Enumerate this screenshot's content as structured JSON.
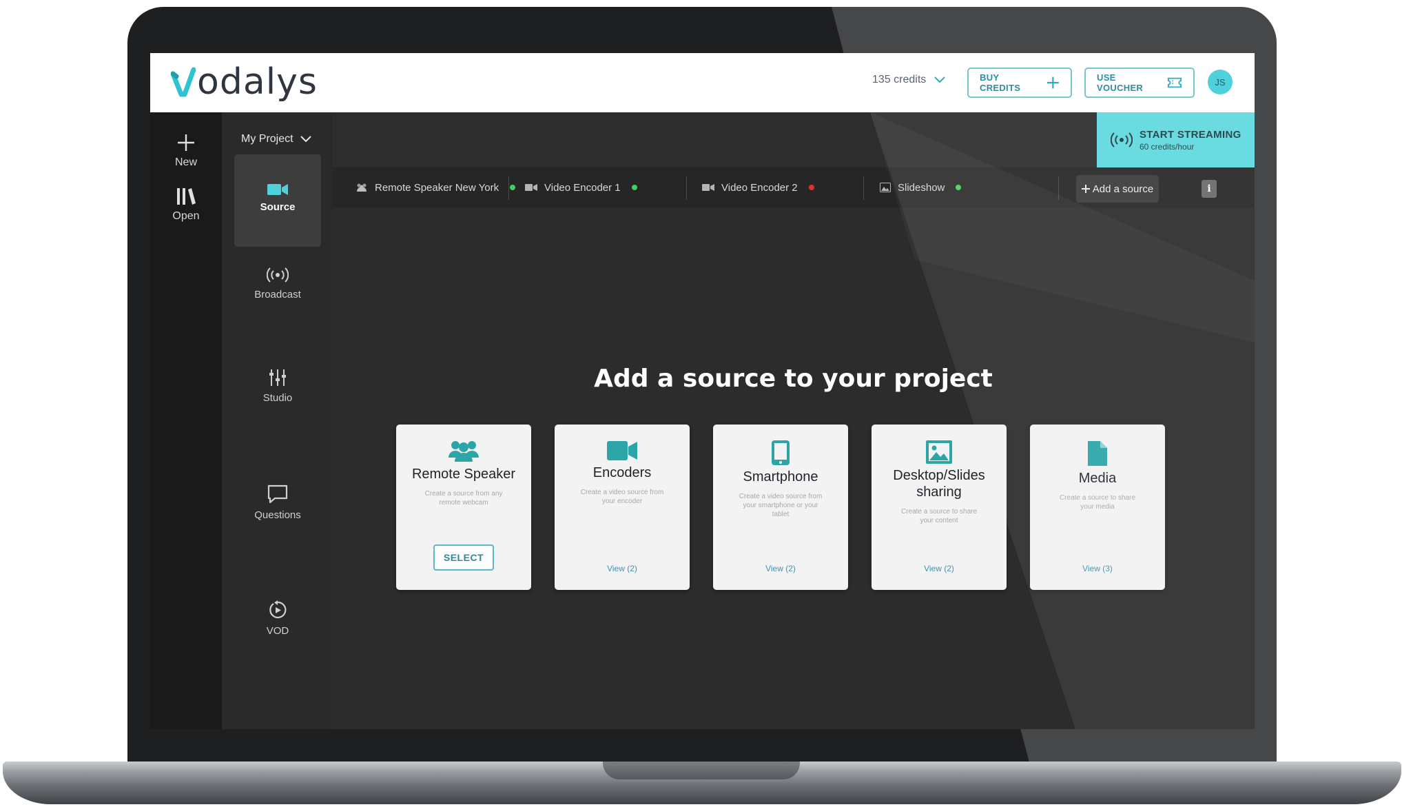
{
  "brand": {
    "logo_text": "odalys",
    "accent": "#4fd1db"
  },
  "header": {
    "credits": "135 credits",
    "buy_credits": "BUY CREDITS",
    "use_voucher": "USE VOUCHER",
    "user_initials": "JS"
  },
  "rail": [
    {
      "label": "New",
      "icon": "plus-icon"
    },
    {
      "label": "Open",
      "icon": "library-icon"
    }
  ],
  "nav": {
    "project": "My Project",
    "items": [
      {
        "label": "Source",
        "icon": "video-camera-icon",
        "active": true
      },
      {
        "label": "Broadcast",
        "icon": "broadcast-icon"
      },
      {
        "label": "Studio",
        "icon": "sliders-icon"
      },
      {
        "label": "Questions",
        "icon": "chat-bubble-icon"
      },
      {
        "label": "VOD",
        "icon": "replay-icon"
      }
    ]
  },
  "stream": {
    "title": "START STREAMING",
    "subtitle": "60 credits/hour"
  },
  "tabs": [
    {
      "label": "Remote Speaker New York",
      "icon": "users-icon",
      "status": "#3fd15f"
    },
    {
      "label": "Video Encoder 1",
      "icon": "video-camera-icon",
      "status": "#3fd15f"
    },
    {
      "label": "Video Encoder 2",
      "icon": "video-camera-icon",
      "status": "#e0322f"
    },
    {
      "label": "Slideshow",
      "icon": "image-icon",
      "status": "#3fd15f"
    }
  ],
  "add_source": "Add a source",
  "info": "i",
  "main": {
    "title": "Add a source to your project",
    "cards": [
      {
        "title": "Remote Speaker",
        "desc": "Create a source from any remote webcam",
        "action": "SELECT",
        "icon": "users-icon"
      },
      {
        "title": "Encoders",
        "desc": "Create a video source from your encoder",
        "action": "View (2)",
        "icon": "video-camera-icon"
      },
      {
        "title": "Smartphone",
        "desc": "Create a video source from your smartphone or your tablet",
        "action": "View (2)",
        "icon": "smartphone-icon"
      },
      {
        "title": "Desktop/Slides sharing",
        "desc": "Create a source to share your content",
        "action": "View (2)",
        "icon": "image-icon"
      },
      {
        "title": "Media",
        "desc": "Create a source to share your media",
        "action": "View (3)",
        "icon": "file-icon"
      }
    ]
  }
}
